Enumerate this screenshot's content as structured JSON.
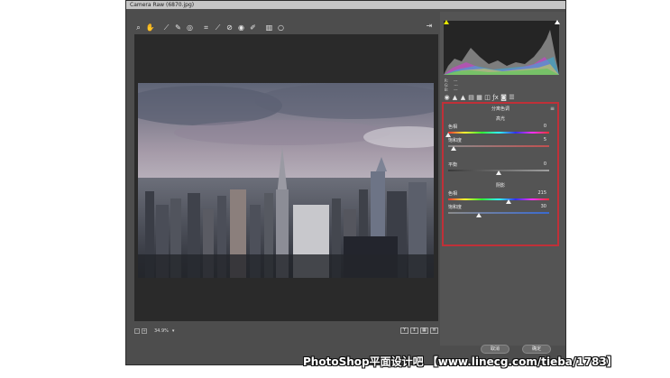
{
  "window": {
    "title": "Camera Raw (6870.jpg)"
  },
  "toolbar": {
    "tools": [
      {
        "name": "zoom-tool-icon",
        "glyph": "⌕"
      },
      {
        "name": "hand-tool-icon",
        "glyph": "✋"
      },
      {
        "name": "white-balance-tool-icon",
        "glyph": "⟋"
      },
      {
        "name": "color-sampler-tool-icon",
        "glyph": "✎"
      },
      {
        "name": "targeted-adjustment-tool-icon",
        "glyph": "◎"
      },
      {
        "name": "crop-tool-icon",
        "glyph": "⌗"
      },
      {
        "name": "straighten-tool-icon",
        "glyph": "⟋"
      },
      {
        "name": "spot-removal-tool-icon",
        "glyph": "⊘"
      },
      {
        "name": "red-eye-tool-icon",
        "glyph": "◉"
      },
      {
        "name": "adjustment-brush-icon",
        "glyph": "✐"
      },
      {
        "name": "graduated-filter-icon",
        "glyph": "▥"
      },
      {
        "name": "radial-filter-icon",
        "glyph": "○"
      }
    ],
    "open_preferences_glyph": "⇥"
  },
  "statusbar": {
    "zoom_value": "34.9%",
    "zoom_minus": "-",
    "zoom_plus": "+",
    "view_buttons": [
      "Y",
      "⇕",
      "▦",
      "≡"
    ]
  },
  "histogram": {
    "rgb_labels": [
      {
        "key": "R:",
        "value": "---"
      },
      {
        "key": "G:",
        "value": "---"
      },
      {
        "key": "B:",
        "value": "---"
      }
    ],
    "clip_color": "#e5e500",
    "clip_highlight_color": "#ffffff"
  },
  "panel_tabs": [
    "◉",
    "▲",
    "▲",
    "▤",
    "▦",
    "◫",
    "ƒx",
    "◙",
    "☰"
  ],
  "split_toning": {
    "title": "分离色调",
    "menu_glyph": "≡",
    "highlights": {
      "heading": "高光",
      "hue_label": "色相",
      "hue_value": "0",
      "hue_pos": 0.0,
      "sat_label": "饱和度",
      "sat_value": "5",
      "sat_pos": 0.05
    },
    "balance": {
      "label": "平衡",
      "value": "0",
      "pos": 0.5
    },
    "shadows": {
      "heading": "阴影",
      "hue_label": "色相",
      "hue_value": "215",
      "hue_pos": 0.597,
      "sat_label": "饱和度",
      "sat_value": "30",
      "sat_pos": 0.3
    }
  },
  "buttons": {
    "cancel": "取消",
    "ok": "确定"
  },
  "watermark": "PhotoShop平面设计吧 【www.linecg.com/tieba/1783】",
  "colors": {
    "highlight_box": "#c03038",
    "panel_bg": "#545454",
    "canvas_bg": "#2a2a2a"
  }
}
